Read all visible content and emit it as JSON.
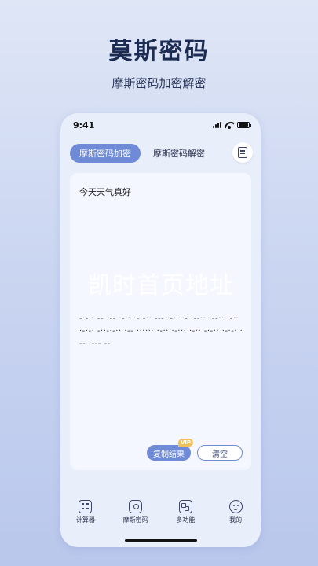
{
  "promo": {
    "title": "莫斯密码",
    "subtitle": "摩斯密码加密解密"
  },
  "status_bar": {
    "time": "9:41"
  },
  "tabs": {
    "encrypt_label": "摩斯密码加密",
    "decrypt_label": "摩斯密码解密"
  },
  "editor": {
    "input_text": "今天天气真好",
    "output_text": "-·-·· -- ·-- ·-·· ·-·-·· --- ·-·· ·- ·--·· ·--·· ·-·· ·-·-· -··-·-·· ·-- ······ ·-·· ·-··· ·-·· -·-·· ·-·-· ·-- ·--- --"
  },
  "watermark": {
    "text": "凯时首页地址"
  },
  "actions": {
    "copy_label": "复制结果",
    "vip_badge": "VIP",
    "clear_label": "清空"
  },
  "tabbar": {
    "items": [
      {
        "label": "计算器",
        "icon": "calculator-icon"
      },
      {
        "label": "摩斯密码",
        "icon": "lock-icon"
      },
      {
        "label": "多功能",
        "icon": "grid-icon"
      },
      {
        "label": "我的",
        "icon": "smile-icon"
      }
    ]
  },
  "colors": {
    "accent": "#6f8ad6",
    "vip": "#f0c15a"
  }
}
